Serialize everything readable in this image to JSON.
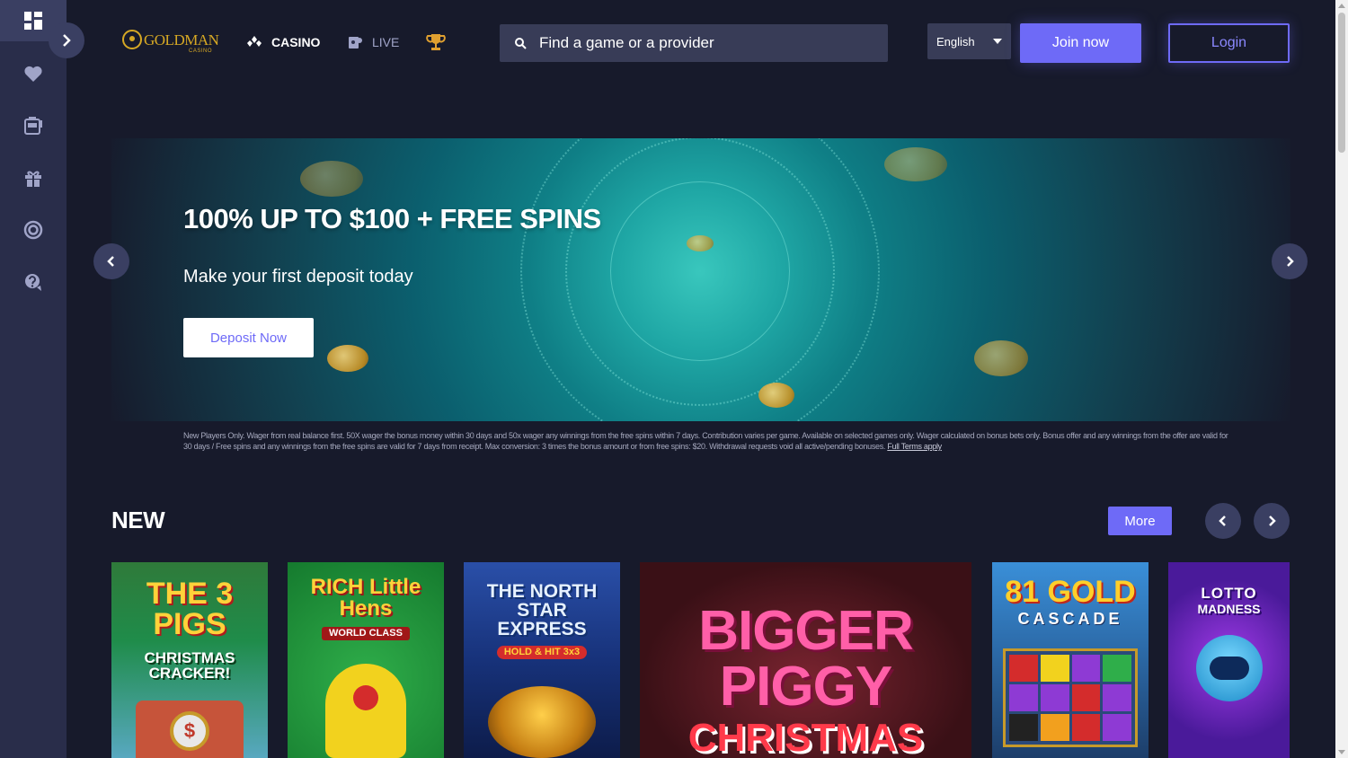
{
  "sidebar": {
    "items": [
      {
        "icon": "dashboard-icon",
        "active": true
      },
      {
        "icon": "heart-icon"
      },
      {
        "icon": "slot-machine-icon"
      },
      {
        "icon": "gift-icon"
      },
      {
        "icon": "vip-chip-icon"
      },
      {
        "icon": "help-chat-icon"
      }
    ]
  },
  "header": {
    "logo_text": "GOLDMAN",
    "logo_sub": "CASINO",
    "nav": [
      {
        "label": "CASINO",
        "icon": "casino-chips-icon"
      },
      {
        "label": "LIVE",
        "icon": "live-dealer-icon"
      },
      {
        "label": "",
        "icon": "trophy-icon"
      }
    ],
    "search_placeholder": "Find a game or a provider",
    "language": "English",
    "join_label": "Join now",
    "login_label": "Login"
  },
  "hero": {
    "title": "100% UP TO $100 + FREE SPINS",
    "subtitle": "Make your first deposit today",
    "cta_label": "Deposit Now",
    "terms": "New Players Only. Wager from real balance first. 50X wager the bonus money within 30 days and 50x wager any winnings from the free spins within 7 days. Contribution varies per game. Available on selected games only. Wager calculated on bonus bets only. Bonus offer and any winnings from the offer are valid for 30 days / Free spins and any winnings from the free spins are valid for 7 days from receipt. Max conversion: 3 times the bonus amount or from free spins: $20. Withdrawal requests void all active/pending bonuses.",
    "terms_link": "Full Terms apply"
  },
  "section": {
    "title": "NEW",
    "more_label": "More"
  },
  "games": [
    {
      "title": "THE 3 PIGS",
      "subtitle": "CHRISTMAS CRACKER!"
    },
    {
      "title": "RICH Little Hens",
      "subtitle": "WORLD CLASS"
    },
    {
      "title": "THE NORTH STAR EXPRESS",
      "subtitle": "HOLD & HIT 3x3"
    },
    {
      "title": "BIGGER PIGGY",
      "subtitle": "CHRISTMAS"
    },
    {
      "title": "81 GOLD",
      "subtitle": "CASCADE"
    },
    {
      "title": "LOTTO",
      "subtitle": "MADNESS"
    }
  ],
  "colors": {
    "accent": "#6e6af7",
    "background": "#171a2b",
    "sidebar": "#292d4a",
    "gold": "#d6a824"
  }
}
